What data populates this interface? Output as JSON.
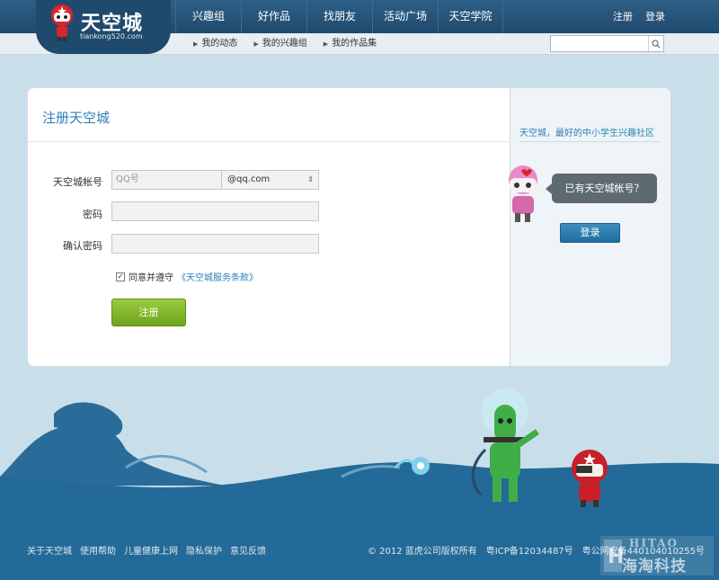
{
  "logo": {
    "text": "天空城",
    "url": "tiankong520.com"
  },
  "nav": {
    "items": [
      "兴趣组",
      "好作品",
      "找朋友",
      "活动广场",
      "天空学院"
    ],
    "register_link": "注册",
    "login_link": "登录"
  },
  "subnav": {
    "items": [
      "我的动态",
      "我的兴趣组",
      "我的作品集"
    ]
  },
  "search": {
    "placeholder": ""
  },
  "form": {
    "title": "注册天空城",
    "account_label": "天空城帐号",
    "account_placeholder": "QQ号",
    "domain_value": "@qq.com",
    "password_label": "密码",
    "confirm_label": "确认密码",
    "agree_text": "同意并遵守",
    "terms_text": "《天空城服务条款》",
    "agree_checked": true,
    "submit_label": "注册"
  },
  "side": {
    "slogan": "天空城，最好的中小学生兴趣社区",
    "bubble": "已有天空城帐号？",
    "login_label": "登录"
  },
  "footer": {
    "links": [
      "关于天空城",
      "使用帮助",
      "儿童健康上网",
      "隐私保护",
      "意见反馈"
    ],
    "copyright": "© 2012 蓝虎公司版权所有　粤ICP备12034487号　粤公网安备44010401025",
    "copyright_tail": "5号"
  },
  "watermark": {
    "en": "HITAO",
    "cn": "海淘科技"
  },
  "colors": {
    "nav_bg": "#1f4a6d",
    "accent_blue": "#2d7fb5",
    "register_green": "#7cb527",
    "login_blue": "#2a7aab",
    "sky": "#c8dfea",
    "sea": "#246a98"
  }
}
